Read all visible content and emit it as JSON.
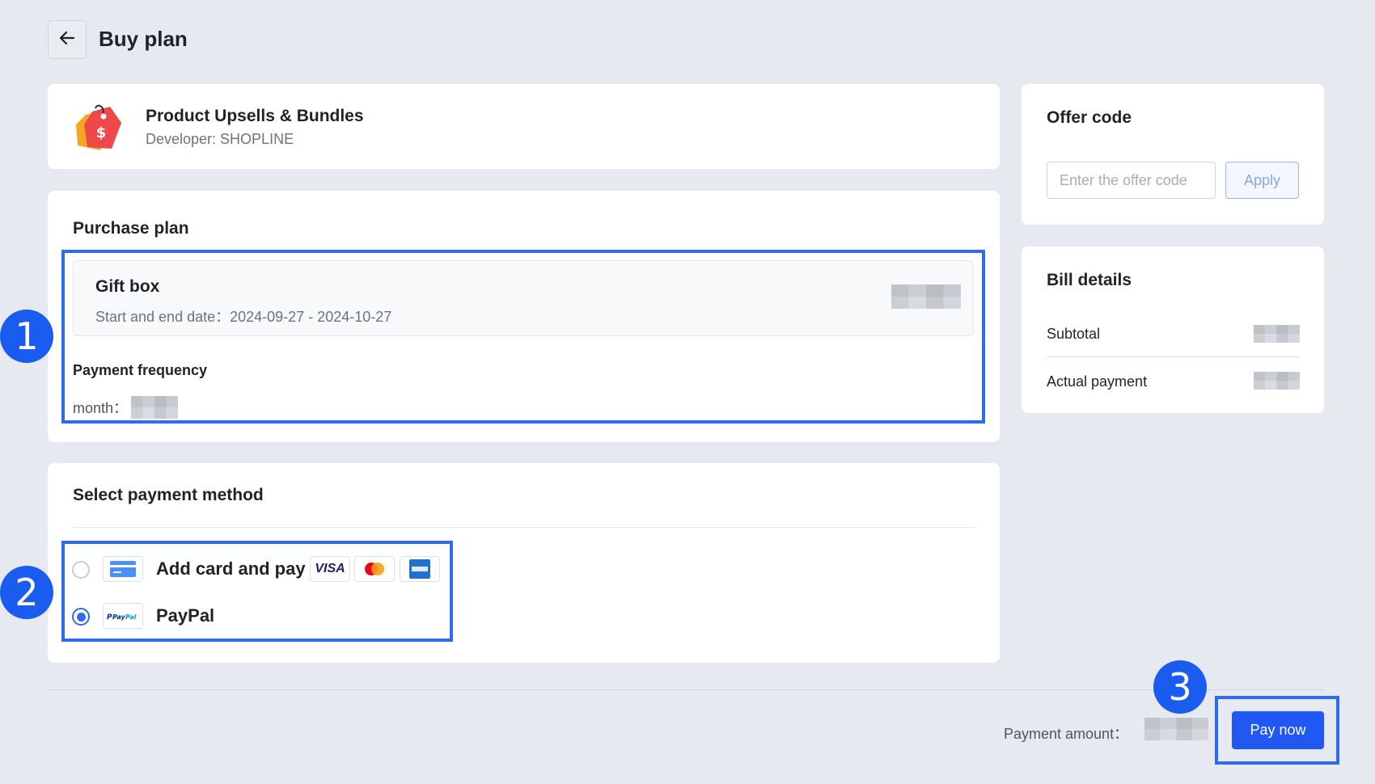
{
  "header": {
    "title": "Buy plan"
  },
  "app": {
    "name": "Product Upsells & Bundles",
    "developer": "Developer: SHOPLINE"
  },
  "purchase_plan": {
    "title": "Purchase plan",
    "plan_name": "Gift box",
    "dates": "Start and end date：2024-09-27 - 2024-10-27",
    "frequency_label": "Payment frequency",
    "frequency_value": "month："
  },
  "payment_method": {
    "title": "Select payment method",
    "options": [
      {
        "label": "Add card and pay",
        "selected": false
      },
      {
        "label": "PayPal",
        "selected": true
      }
    ],
    "brands": {
      "visa": "VISA"
    }
  },
  "offer": {
    "title": "Offer code",
    "placeholder": "Enter the offer code",
    "apply_label": "Apply"
  },
  "bill": {
    "title": "Bill details",
    "subtotal_label": "Subtotal",
    "actual_label": "Actual payment"
  },
  "footer": {
    "amount_label": "Payment amount：",
    "pay_label": "Pay now"
  },
  "markers": [
    "1",
    "2",
    "3"
  ],
  "colors": {
    "accent": "#2157f2",
    "highlight": "#2f6bf0",
    "background": "#e6e9ef"
  }
}
